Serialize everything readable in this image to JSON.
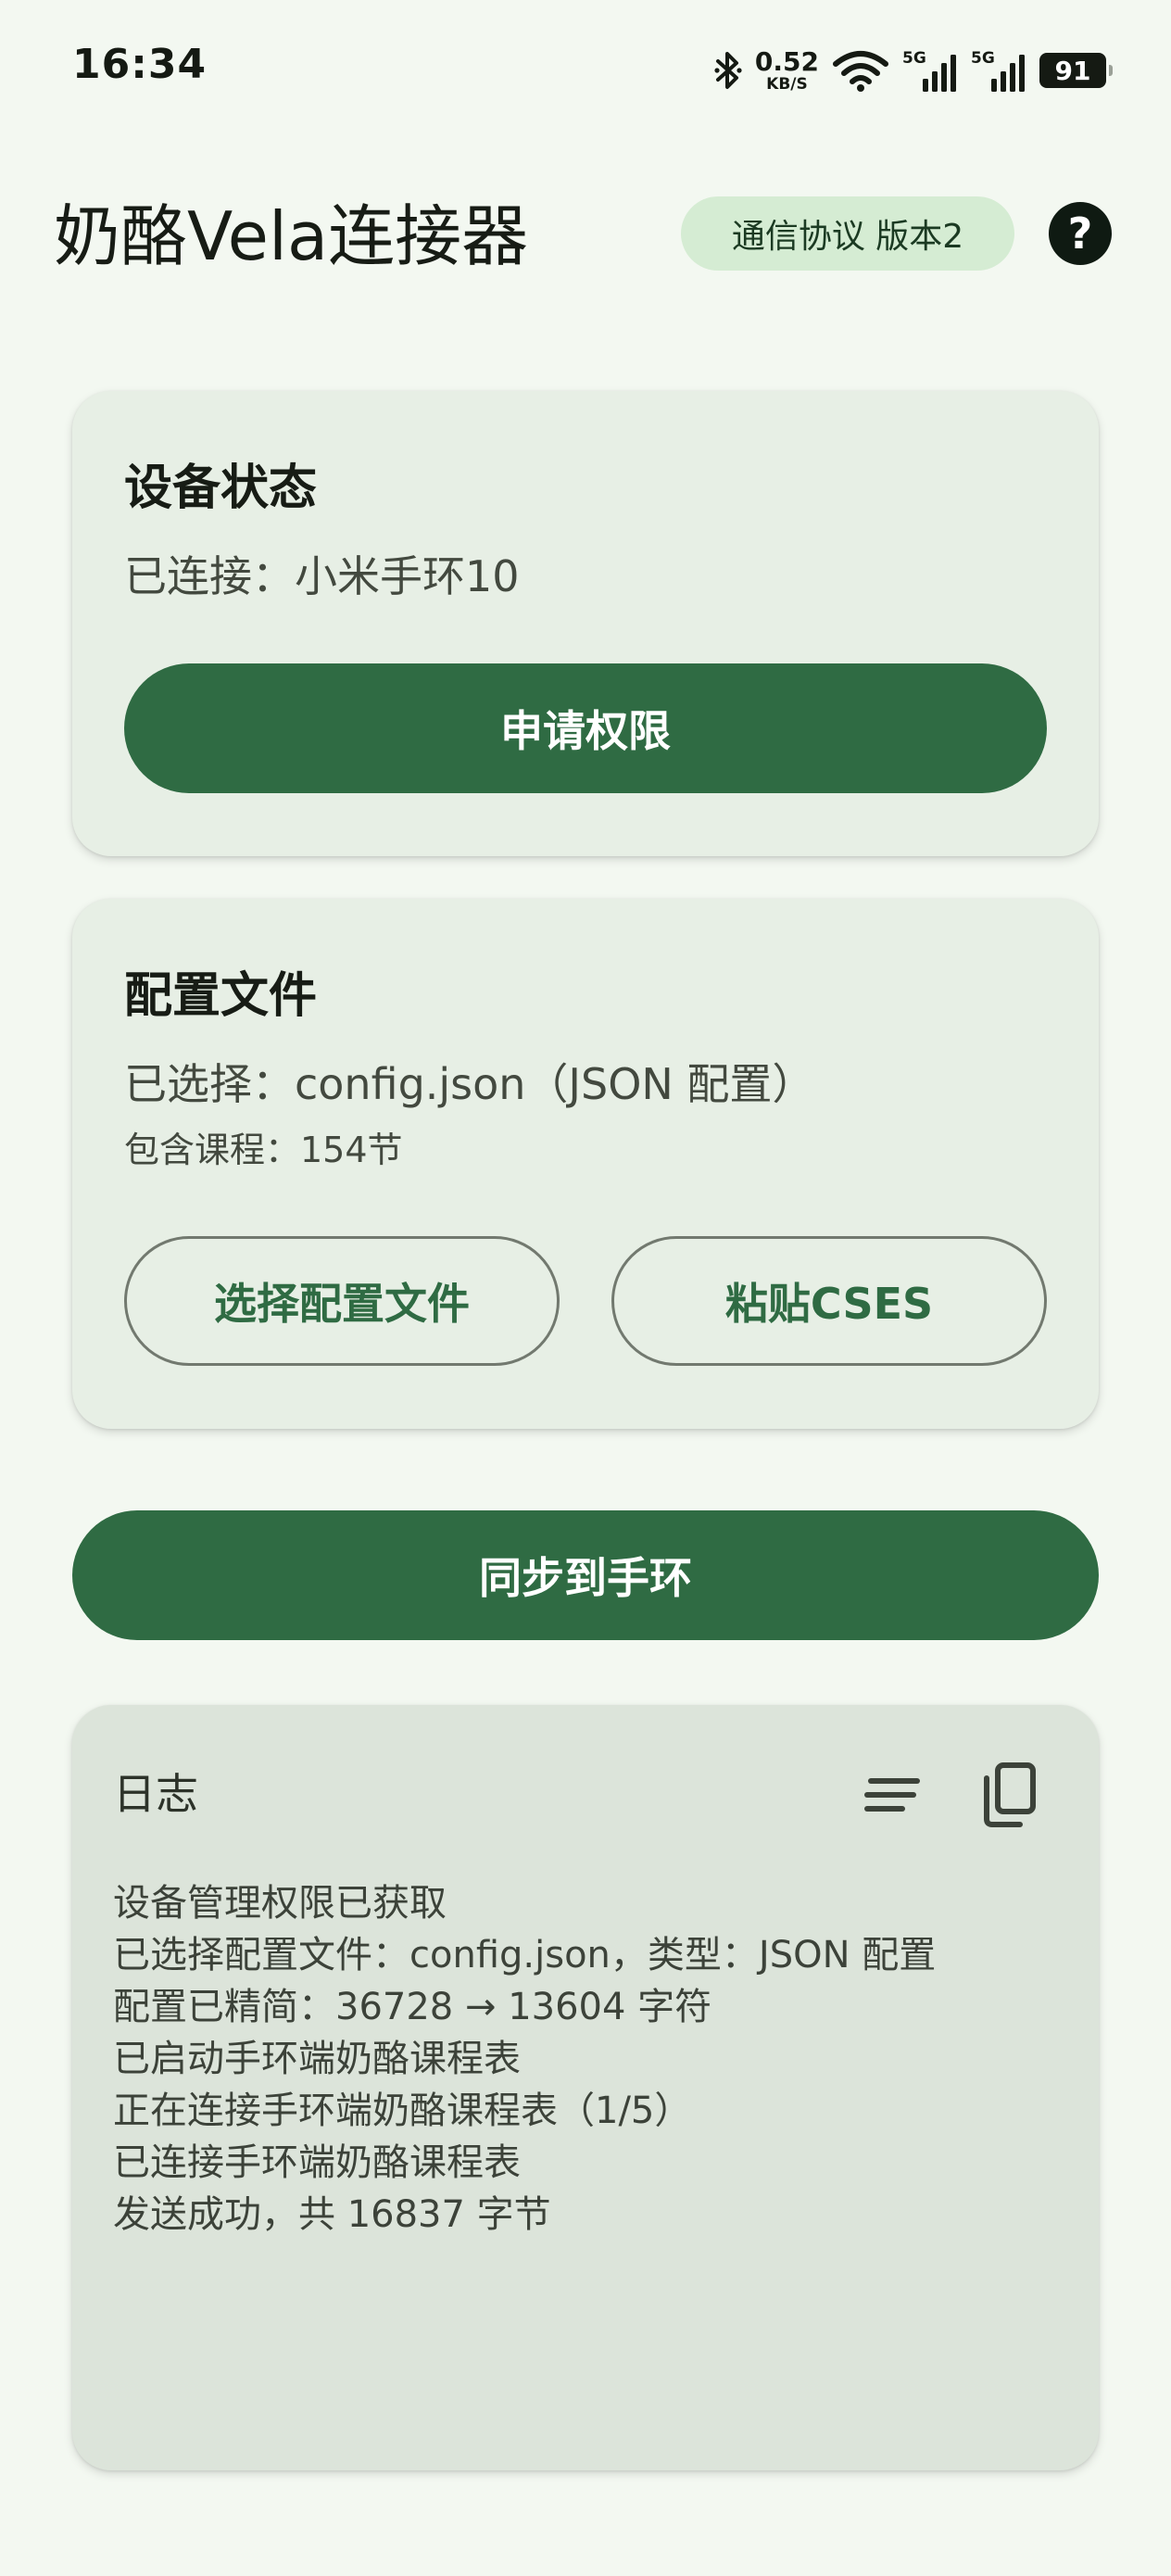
{
  "status_bar": {
    "time": "16:34",
    "net_speed_value": "0.52",
    "net_speed_unit": "KB/S",
    "signal_1_label": "5G",
    "signal_2_label": "5G",
    "battery": "91"
  },
  "header": {
    "title": "奶酪Vela连接器",
    "protocol_chip": "通信协议 版本2",
    "help_symbol": "?"
  },
  "device_card": {
    "title": "设备状态",
    "status_text": "已连接：小米手环10",
    "request_permission_label": "申请权限"
  },
  "config_card": {
    "title": "配置文件",
    "selected_text": "已选择：config.json（JSON 配置）",
    "course_count_text": "包含课程：154节",
    "select_file_label": "选择配置文件",
    "paste_cses_label": "粘贴CSES"
  },
  "sync_button_label": "同步到手环",
  "log_card": {
    "title": "日志",
    "entries": [
      "设备管理权限已获取",
      "已选择配置文件：config.json，类型：JSON 配置",
      "配置已精简：36728 → 13604 字符",
      "已启动手环端奶酪课程表",
      "正在连接手环端奶酪课程表（1/5）",
      "已连接手环端奶酪课程表",
      "发送成功，共 16837 字节"
    ]
  },
  "colors": {
    "background": "#f3f8f1",
    "card": "#e7efe5",
    "log_card": "#dce4da",
    "primary": "#2f6b43",
    "chip": "#d5ecd3"
  }
}
